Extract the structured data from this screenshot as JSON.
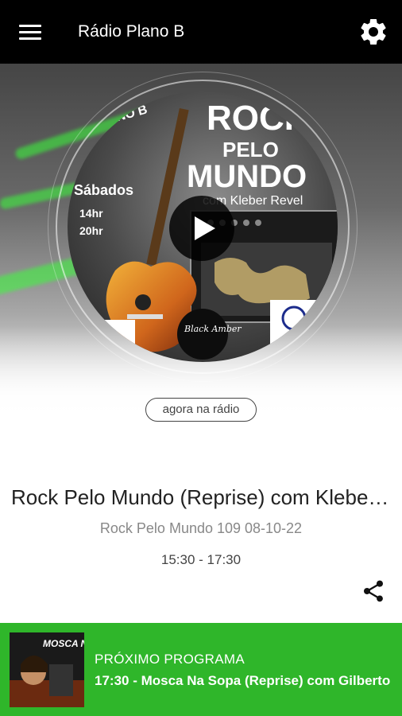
{
  "app": {
    "title": "Rádio Plano B"
  },
  "icons": {
    "menu": "menu-icon",
    "settings": "gear-icon",
    "play": "play-icon",
    "share": "share-icon"
  },
  "cover": {
    "text_main": "ROCK",
    "text_pelo": "PELO",
    "text_mundo": "MUNDO",
    "text_host": "com Kleber Revel",
    "text_brand": "PLANO B",
    "text_days": "Sábados",
    "text_time1": "14hr",
    "text_time2": "20hr",
    "text_black_amber": "Black Amber"
  },
  "now": {
    "pill_label": "agora na rádio",
    "program_title": "Rock Pelo Mundo (Reprise) com Kleber Revel",
    "episode": "Rock Pelo Mundo 109 08-10-22",
    "time": "15:30 - 17:30"
  },
  "next": {
    "label": "PRÓXIMO PROGRAMA",
    "title": "17:30 - Mosca Na Sopa (Reprise) com Gilberto",
    "thumb_text": "MOSCA NA SOPA"
  },
  "colors": {
    "topbar": "#000000",
    "next_bar": "#2fb62a",
    "accent_green": "#3aff3a"
  }
}
